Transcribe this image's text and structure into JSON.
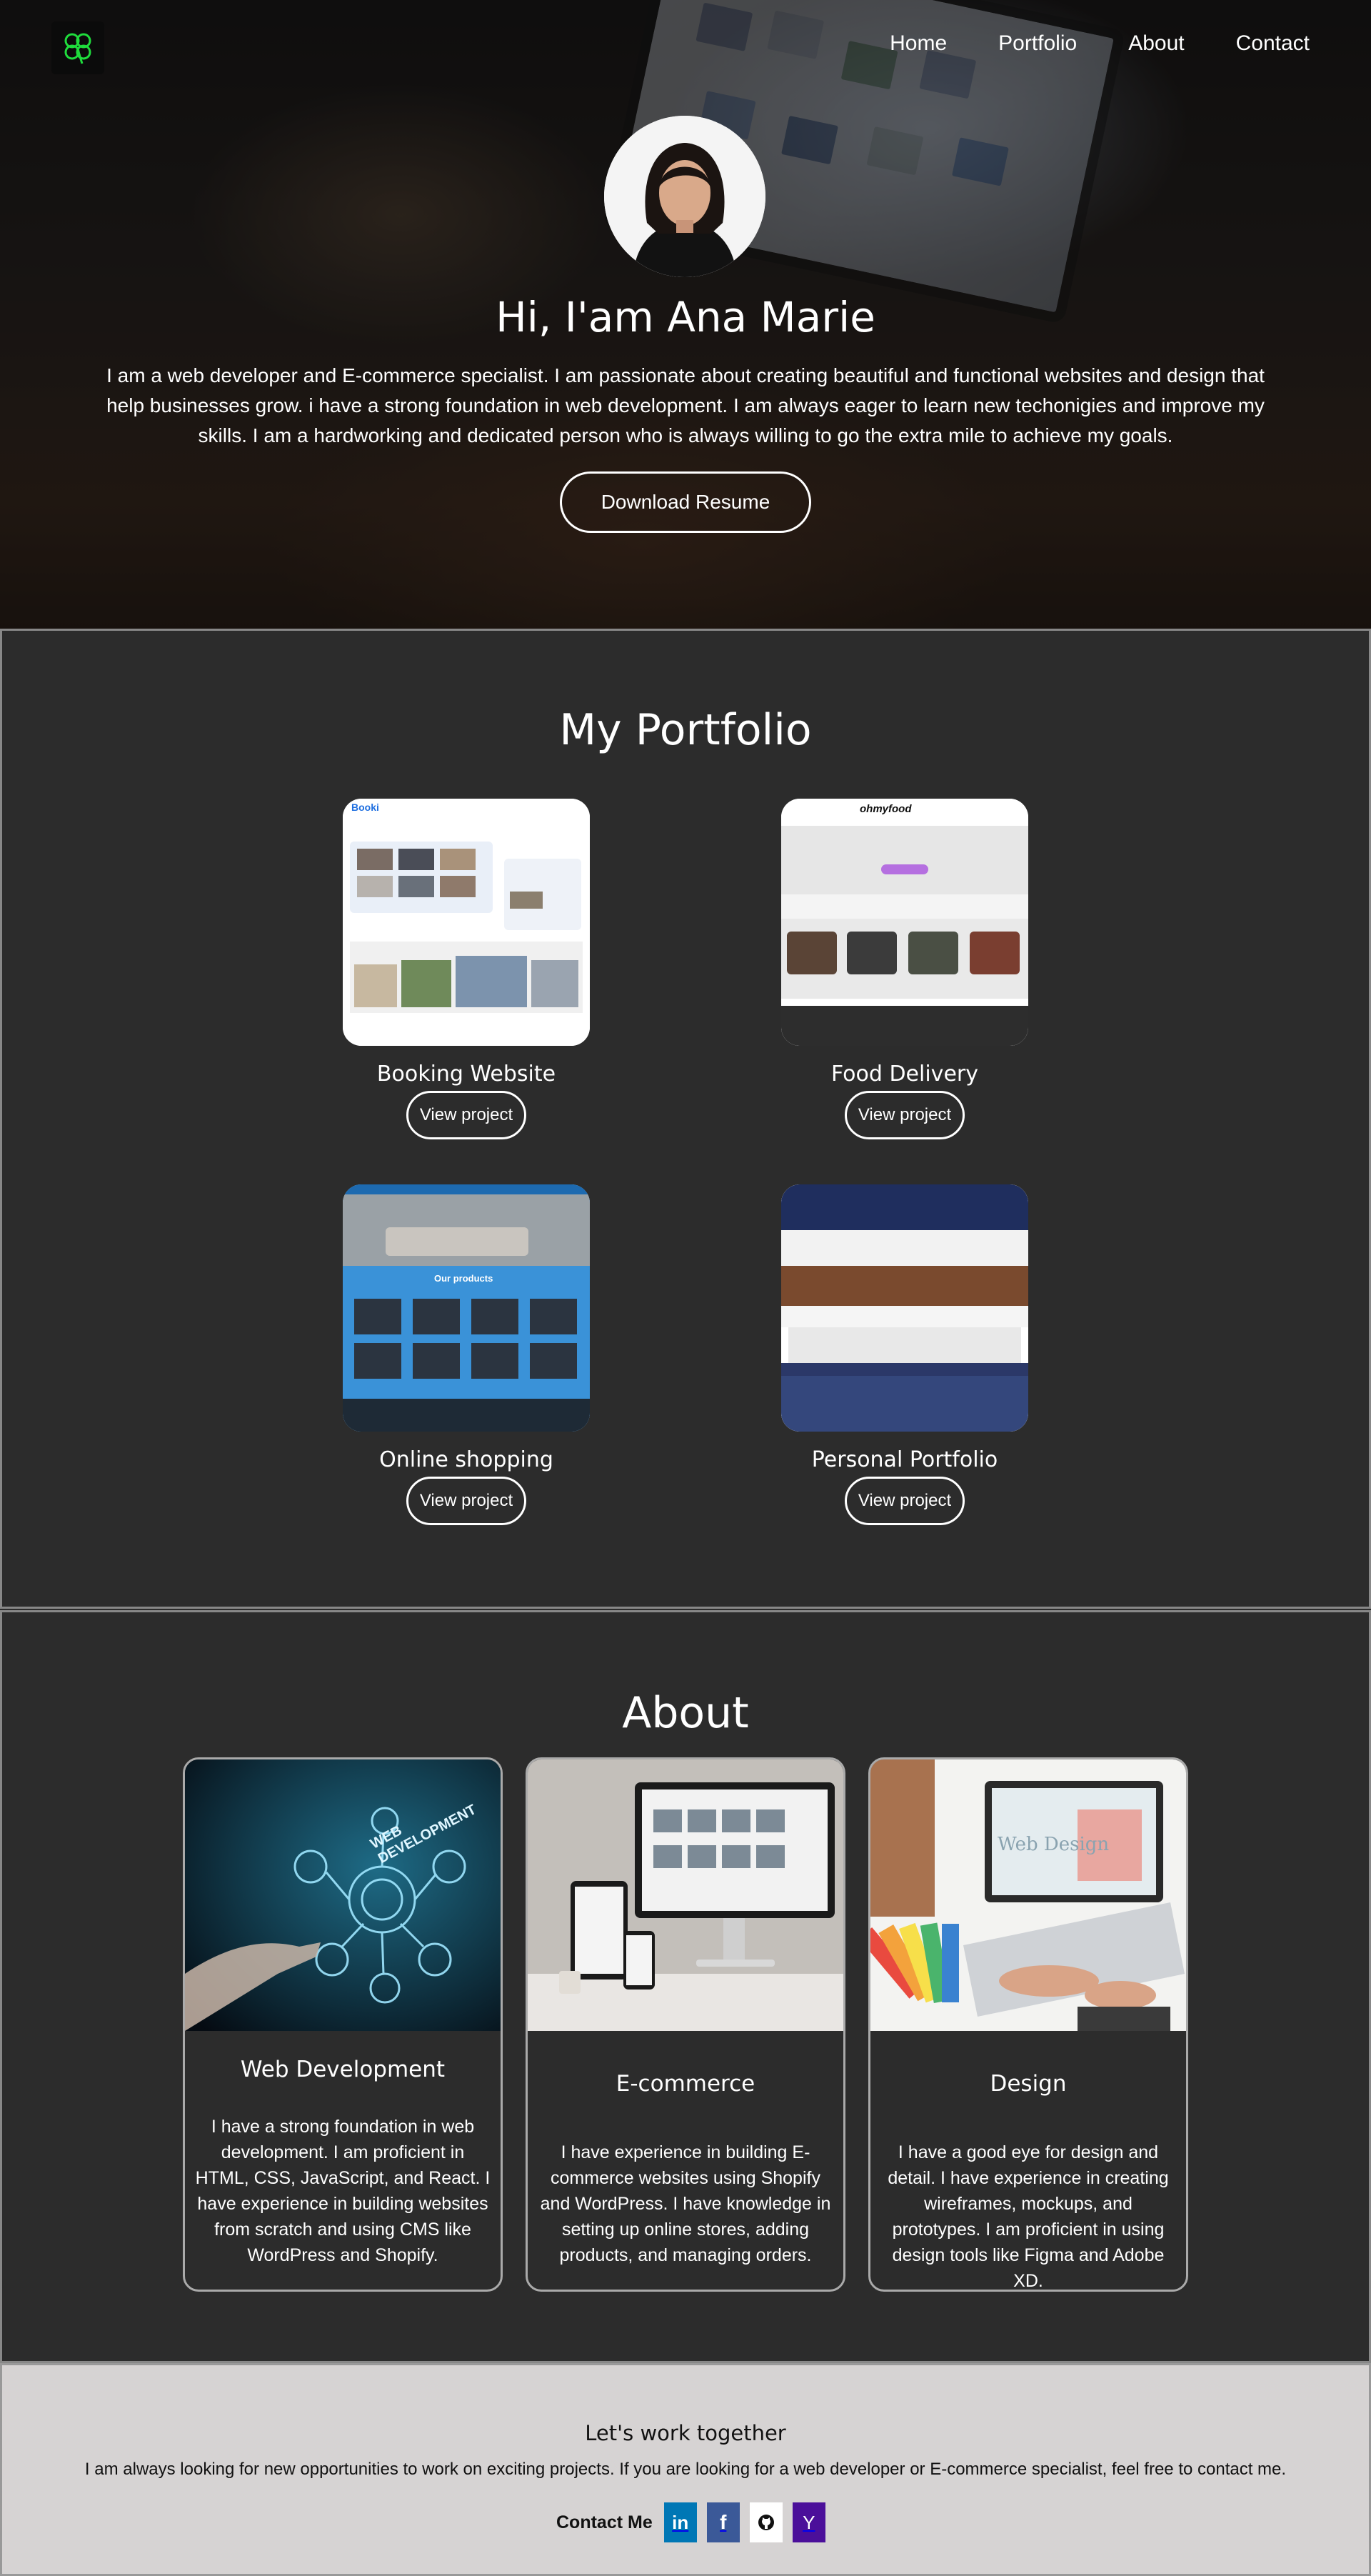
{
  "nav": {
    "logo_icon": "clover-icon",
    "items": [
      {
        "label": "Home"
      },
      {
        "label": "Portfolio"
      },
      {
        "label": "About"
      },
      {
        "label": "Contact"
      }
    ]
  },
  "hero": {
    "title": "Hi, I'am Ana Marie",
    "text": "I am a web developer and E-commerce specialist. I am passionate about creating beautiful and functional websites and design that help businesses grow. i have a strong foundation in web development. I am always eager to learn new techonigies and improve my skills. I am a hardworking and dedicated person who is always willing to go the extra mile to achieve my goals.",
    "button": "Download Resume"
  },
  "portfolio": {
    "title": "My Portfolio",
    "projects": [
      {
        "title": "Booking Website",
        "button": "View project",
        "shot_label": "Booki"
      },
      {
        "title": "Food Delivery",
        "button": "View project",
        "shot_label": "ohmyfood"
      },
      {
        "title": "Online shopping",
        "button": "View project",
        "shot_label": "Our products"
      },
      {
        "title": "Personal Portfolio",
        "button": "View project",
        "shot_label": ""
      }
    ]
  },
  "about": {
    "title": "About",
    "cards": [
      {
        "title": "Web Development",
        "text": "I have a strong foundation in web development. I am proficient in HTML, CSS, JavaScript, and React. I have experience in building websites from scratch and using CMS like WordPress and Shopify.",
        "image_label": "WEB DEVELOPMENT"
      },
      {
        "title": "E-commerce",
        "text": "I have experience in building E-commerce websites using Shopify and WordPress. I have knowledge in setting up online stores, adding products, and managing orders."
      },
      {
        "title": "Design",
        "text": "I have a good eye for design and detail. I have experience in creating wireframes, mockups, and prototypes. I am proficient in using design tools like Figma and Adobe XD.",
        "image_label": "Web Design"
      }
    ]
  },
  "footer": {
    "title": "Let's work together",
    "text": "I am always looking for new opportunities to work on exciting projects. If you are looking for a web developer or E-commerce specialist, feel free to contact me.",
    "contact_label": "Contact Me",
    "socials": [
      {
        "icon": "linkedin-icon",
        "glyph": "in",
        "color": "#0077b5"
      },
      {
        "icon": "facebook-icon",
        "glyph": "f",
        "color": "#3b5998"
      },
      {
        "icon": "github-icon",
        "glyph": "",
        "color": "#ffffff"
      },
      {
        "icon": "yahoo-icon",
        "glyph": "Y",
        "color": "#4b0f9a"
      }
    ]
  }
}
